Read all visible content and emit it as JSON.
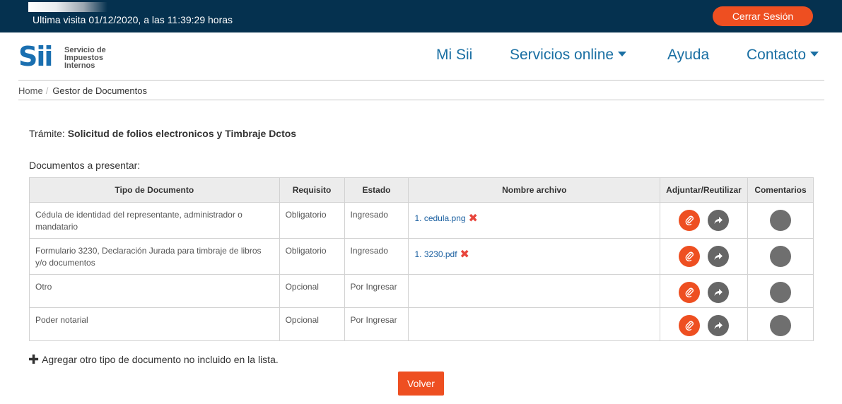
{
  "topbar": {
    "last_visit": "Ultima visita 01/12/2020, a las 11:39:29 horas",
    "logout_label": "Cerrar Sesión"
  },
  "logo": {
    "text": "Sii",
    "org_line1": "Servicio de",
    "org_line2": "Impuestos",
    "org_line3": "Internos"
  },
  "nav": {
    "items": [
      {
        "label": "Mi Sii"
      },
      {
        "label": "Servicios online"
      },
      {
        "label": "Ayuda"
      },
      {
        "label": "Contacto"
      }
    ]
  },
  "breadcrumb": {
    "home": "Home",
    "separator": "/",
    "current": "Gestor de Documentos"
  },
  "tramite": {
    "label": "Trámite:",
    "value": "Solicitud de folios electronicos y Timbraje Dctos"
  },
  "documents_title": "Documentos a presentar:",
  "table": {
    "headers": [
      "Tipo de Documento",
      "Requisito",
      "Estado",
      "Nombre archivo",
      "Adjuntar/Reutilizar",
      "Comentarios"
    ],
    "rows": [
      {
        "tipo": "Cédula de identidad del representante, administrador o mandatario",
        "requisito": "Obligatorio",
        "estado": "Ingresado",
        "archivo": "1. cedula.png"
      },
      {
        "tipo": "Formulario 3230, Declaración Jurada para timbraje de libros y/o documentos",
        "requisito": "Obligatorio",
        "estado": "Ingresado",
        "archivo": "1. 3230.pdf"
      },
      {
        "tipo": "Otro",
        "requisito": "Opcional",
        "estado": "Por Ingresar",
        "archivo": ""
      },
      {
        "tipo": "Poder notarial",
        "requisito": "Opcional",
        "estado": "Por Ingresar",
        "archivo": ""
      }
    ]
  },
  "add_other": "Agregar otro tipo de documento no incluido en la lista.",
  "back_label": "Volver",
  "colors": {
    "topbar": "#05314f",
    "accent": "#ee4f21",
    "link": "#1a6fa3",
    "delete": "#e8453c"
  }
}
